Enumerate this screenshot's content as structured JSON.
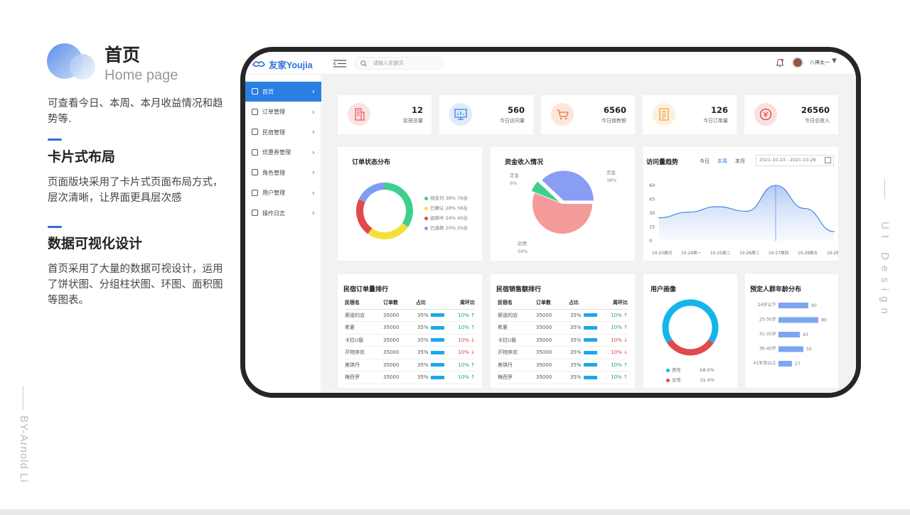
{
  "left": {
    "title_zh": "首页",
    "title_en": "Home page",
    "desc1": "可查看今日、本周、本月收益情况和趋势等.",
    "h2": "卡片式布局",
    "desc2": "页面版块采用了卡片式页面布局方式，层次清晰，让界面更具层次感",
    "h3": "数据可视化设计",
    "desc3": "首页采用了大量的数据可视设计，运用了饼状图、分组柱状图、环图、面积图等图表。",
    "byline": "BY-Arnold Li",
    "side_text": "UI Design"
  },
  "app": {
    "logo": "友家Youjia",
    "search_placeholder": "请输入关键词",
    "username": "八神太一",
    "nav": [
      {
        "label": "首页",
        "icon": "home-icon"
      },
      {
        "label": "订单管理",
        "icon": "document-icon"
      },
      {
        "label": "民宿管理",
        "icon": "building-icon"
      },
      {
        "label": "优惠券管理",
        "icon": "ticket-icon"
      },
      {
        "label": "角色管理",
        "icon": "users-icon"
      },
      {
        "label": "用户管理",
        "icon": "user-icon"
      },
      {
        "label": "操作日志",
        "icon": "gear-icon"
      }
    ],
    "stats": [
      {
        "value": "12",
        "label": "民宿总量",
        "icon": "building-icon",
        "bg": "#fbe3e3",
        "fg": "#e45c5c"
      },
      {
        "value": "560",
        "label": "今日访问量",
        "icon": "monitor-icon",
        "bg": "#dfeafb",
        "fg": "#3b7de0"
      },
      {
        "value": "6560",
        "label": "今日销售额",
        "icon": "cart-icon",
        "bg": "#fde6dc",
        "fg": "#f2703e"
      },
      {
        "value": "126",
        "label": "今日订单量",
        "icon": "clipboard-icon",
        "bg": "#fdf0de",
        "fg": "#f0a03a"
      },
      {
        "value": "26560",
        "label": "今日总收入",
        "icon": "coin-icon",
        "bg": "#fbe0e0",
        "fg": "#e23d3d"
      }
    ],
    "order_status": {
      "title": "订单状态分布",
      "items": [
        {
          "label": "待支付 38% 76台",
          "color": "#3ecf8e",
          "pct": 38
        },
        {
          "label": "已确认 28% 56台",
          "color": "#f5e03a",
          "pct": 28
        },
        {
          "label": "退款中 24% 40台",
          "color": "#e04a4a",
          "pct": 24
        },
        {
          "label": "已退款 20% 20台",
          "color": "#7c9ef0",
          "pct": 20
        }
      ]
    },
    "income": {
      "title": "资金收入情况",
      "slices": [
        {
          "label": "房费",
          "pct": "56%",
          "value": 56,
          "color": "#f59a9a"
        },
        {
          "label": "定金",
          "pct": "38%",
          "value": 38,
          "color": "#8a9df5"
        },
        {
          "label": "定金",
          "pct": "6%",
          "value": 6,
          "color": "#3ecf8e"
        }
      ]
    },
    "visits": {
      "title": "访问量趋势",
      "tabs": [
        "今日",
        "本周",
        "本月"
      ],
      "active_tab": "本周",
      "date_range": "2021-10-23 - 2021-10-29",
      "yticks": [
        "60",
        "45",
        "30",
        "15",
        "0"
      ],
      "xticks": [
        "10-23周日",
        "10-24周一",
        "10-25周二",
        "10-26周三",
        "10-27周四",
        "10-28周五",
        "10-29周六"
      ]
    },
    "order_rank": {
      "title": "民宿订单量排行",
      "headers": [
        "民宿名",
        "订单数",
        "占比",
        "周环比"
      ],
      "rows": [
        {
          "name": "渠道的店",
          "count": "35000",
          "pct": "35%",
          "wow": "10% ↑",
          "dir": "up"
        },
        {
          "name": "希夏",
          "count": "35000",
          "pct": "35%",
          "wow": "10% ↑",
          "dir": "up"
        },
        {
          "name": "卡拉U盾",
          "count": "35000",
          "pct": "35%",
          "wow": "10% ↓",
          "dir": "down"
        },
        {
          "name": "开物序欢",
          "count": "35000",
          "pct": "35%",
          "wow": "10% ↓",
          "dir": "down"
        },
        {
          "name": "美琪丹",
          "count": "35000",
          "pct": "35%",
          "wow": "10% ↑",
          "dir": "up"
        },
        {
          "name": "梅西罗",
          "count": "35000",
          "pct": "35%",
          "wow": "10% ↑",
          "dir": "up"
        }
      ]
    },
    "sales_rank": {
      "title": "民宿销售额排行",
      "headers": [
        "民宿名",
        "订单数",
        "占比",
        "周环比"
      ],
      "rows": [
        {
          "name": "渠道的店",
          "count": "35000",
          "pct": "35%",
          "wow": "10% ↑",
          "dir": "up"
        },
        {
          "name": "希夏",
          "count": "35000",
          "pct": "35%",
          "wow": "10% ↑",
          "dir": "up"
        },
        {
          "name": "卡拉U盾",
          "count": "35000",
          "pct": "35%",
          "wow": "10% ↓",
          "dir": "down"
        },
        {
          "name": "开物序欢",
          "count": "35000",
          "pct": "35%",
          "wow": "10% ↓",
          "dir": "down"
        },
        {
          "name": "美琪丹",
          "count": "35000",
          "pct": "35%",
          "wow": "10% ↑",
          "dir": "up"
        },
        {
          "name": "梅西罗",
          "count": "35000",
          "pct": "35%",
          "wow": "10% ↑",
          "dir": "up"
        }
      ]
    },
    "portrait": {
      "title": "用户画像",
      "male_label": "男性",
      "male_pct": "68.6%",
      "male_color": "#13b5ea",
      "male_value": 68.6,
      "female_label": "女性",
      "female_pct": "31.4%",
      "female_color": "#e04a4a",
      "female_value": 31.4
    },
    "age": {
      "title": "预定人群年龄分布",
      "bars": [
        {
          "label": "24岁以下",
          "value": 60
        },
        {
          "label": "25-30岁",
          "value": 80
        },
        {
          "label": "31-35岁",
          "value": 43
        },
        {
          "label": "36-40岁",
          "value": 50
        },
        {
          "label": "41岁及以上",
          "value": 27
        }
      ],
      "color": "#7ca6f0"
    }
  },
  "chart_data": [
    {
      "type": "pie",
      "title": "订单状态分布",
      "categories": [
        "待支付",
        "已确认",
        "退款中",
        "已退款"
      ],
      "values": [
        38,
        28,
        24,
        20
      ]
    },
    {
      "type": "pie",
      "title": "资金收入情况",
      "categories": [
        "房费",
        "定金",
        "定金"
      ],
      "values": [
        56,
        38,
        6
      ]
    },
    {
      "type": "area",
      "title": "访问量趋势",
      "categories": [
        "10-23周日",
        "10-24周一",
        "10-25周二",
        "10-26周三",
        "10-27周四",
        "10-28周五",
        "10-29周六"
      ],
      "values": [
        25,
        31,
        37,
        32,
        60,
        35,
        10
      ],
      "ylim": [
        0,
        60
      ]
    },
    {
      "type": "pie",
      "title": "用户画像",
      "categories": [
        "男性",
        "女性"
      ],
      "values": [
        68.6,
        31.4
      ]
    },
    {
      "type": "bar",
      "title": "预定人群年龄分布",
      "categories": [
        "24岁以下",
        "25-30岁",
        "31-35岁",
        "36-40岁",
        "41岁及以上"
      ],
      "values": [
        60,
        80,
        43,
        50,
        27
      ]
    }
  ]
}
